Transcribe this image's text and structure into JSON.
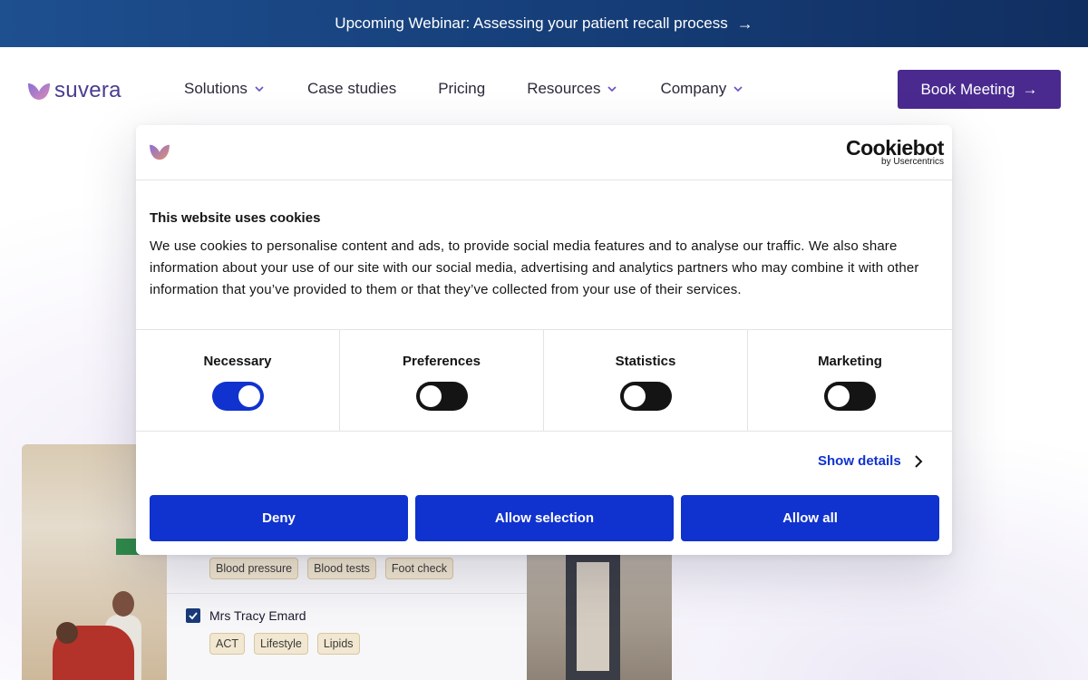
{
  "announcement": {
    "text": "Upcoming Webinar: Assessing your patient recall process",
    "arrow": "→"
  },
  "nav": {
    "logo_text": "suvera",
    "items": [
      {
        "label": "Solutions",
        "has_dropdown": true
      },
      {
        "label": "Case studies",
        "has_dropdown": false
      },
      {
        "label": "Pricing",
        "has_dropdown": false
      },
      {
        "label": "Resources",
        "has_dropdown": true
      },
      {
        "label": "Company",
        "has_dropdown": true
      }
    ],
    "cta": {
      "label": "Book Meeting",
      "arrow": "→"
    }
  },
  "cookie_dialog": {
    "brand": {
      "name": "Cookiebot",
      "sub": "by Usercentrics"
    },
    "title": "This website uses cookies",
    "body": "We use cookies to personalise content and ads, to provide social media features and to analyse our traffic. We also share information about your use of our site with our social media, advertising and analytics partners who may combine it with other information that you’ve provided to them or that they’ve collected from your use of their services.",
    "toggles": [
      {
        "label": "Necessary",
        "state": "on"
      },
      {
        "label": "Preferences",
        "state": "off"
      },
      {
        "label": "Statistics",
        "state": "off"
      },
      {
        "label": "Marketing",
        "state": "off"
      }
    ],
    "show_details": "Show details",
    "buttons": {
      "deny": "Deny",
      "allow_selection": "Allow selection",
      "allow_all": "Allow all"
    }
  },
  "hero_card": {
    "row1_tags": [
      "Blood pressure",
      "Blood tests",
      "Foot check"
    ],
    "row2": {
      "name": "Mrs Tracy Emard",
      "checked": true,
      "tags": [
        "ACT",
        "Lifestyle",
        "Lipids"
      ]
    }
  },
  "colors": {
    "banner": "#163f7a",
    "cta": "#4a2a8f",
    "cookie_accent": "#1032cf"
  }
}
